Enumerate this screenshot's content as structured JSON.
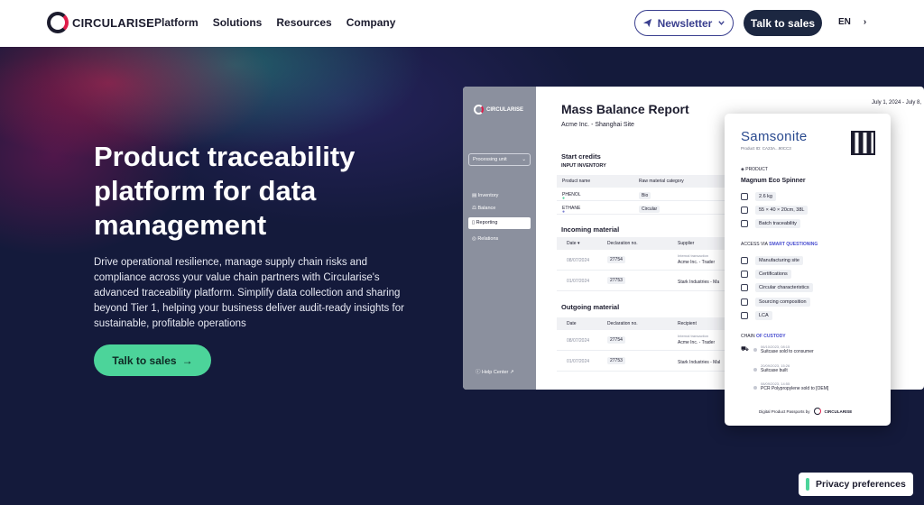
{
  "nav": {
    "logo_text": "CIRCULARISE",
    "links": [
      "Platform",
      "Solutions",
      "Resources",
      "Company"
    ],
    "newsletter_label": "Newsletter",
    "talk_label": "Talk to sales",
    "lang": "EN",
    "lang_chevron": "›"
  },
  "hero": {
    "title": "Product traceability platform for data management",
    "description": "Drive operational resilience, manage supply chain risks and compliance across your value chain partners with Circularise's advanced traceability platform. Simplify data collection and sharing beyond Tier 1, helping your business deliver audit-ready insights for sustainable, profitable operations",
    "cta_label": "Talk to sales",
    "cta_arrow": "→",
    "accent": "#4cd49a"
  },
  "dashboard": {
    "logo_text": "CIRCULARISE",
    "processing_unit": "Processing unit",
    "side_items": [
      "Inventory",
      "Balance",
      "Reporting",
      "Relations"
    ],
    "help": "Help Center",
    "report_title": "Mass Balance Report",
    "site": "Acme Inc. - Shanghai Site",
    "date": "July 1, 2024 - July 8,",
    "start_credits": "Start credits",
    "input_inventory": "INPUT INVENTORY",
    "inv_headers": [
      "Product name",
      "Raw material category"
    ],
    "inv_rows": [
      {
        "name": "PHENOL",
        "cat": "Bio"
      },
      {
        "name": "ETHANE",
        "cat": "Circular"
      }
    ],
    "incoming": "Incoming material",
    "in_headers": [
      "Date",
      "Declaration no.",
      "Supplier"
    ],
    "in_rows": [
      {
        "date": "08/07/2024",
        "decl": "27754",
        "note": "Internal transaction",
        "party": "Acme Inc. - Trader"
      },
      {
        "date": "01/07/2024",
        "decl": "27753",
        "note": "",
        "party": "Stark Industries - Ma"
      }
    ],
    "outgoing": "Outgoing material",
    "out_headers": [
      "Date",
      "Declaration no.",
      "Recipient"
    ],
    "out_rows": [
      {
        "date": "08/07/2024",
        "decl": "27754",
        "note": "Internal transaction",
        "party": "Acme Inc. - Trader"
      },
      {
        "date": "01/07/2024",
        "decl": "27753",
        "note": "",
        "party": "Stark Industries - Mal"
      }
    ]
  },
  "card": {
    "brand": "Samsonite",
    "product_id": "Product ID: CA23A...90CC3",
    "product_label": "PRODUCT",
    "product_name": "Magnum Eco Spinner",
    "attributes": [
      "2.6 kg",
      "55 × 40 × 20cm, 38L",
      "Batch traceability"
    ],
    "access_label": "ACCESS VIA",
    "access_highlight": "SMART QUESTIONING",
    "questions": [
      "Manufacturing site",
      "Certifications",
      "Circular characteristics",
      "Sourcing composition",
      "LCA"
    ],
    "chain_label": "CHAIN",
    "chain_highlight": "OF CUSTODY",
    "chain": [
      {
        "date": "06/10/2023, 08:15",
        "event": "Suitcase sold to consumer"
      },
      {
        "date": "20/09/2023, 15:26",
        "event": "Suitcase built"
      },
      {
        "date": "08/09/2023, 14:55",
        "event": "PCR Polypropylene sold to [OEM]"
      }
    ],
    "dpp_text": "Digital Product Passports by",
    "dpp_logo": "CIRCULARISE"
  },
  "privacy": {
    "label": "Privacy preferences"
  }
}
